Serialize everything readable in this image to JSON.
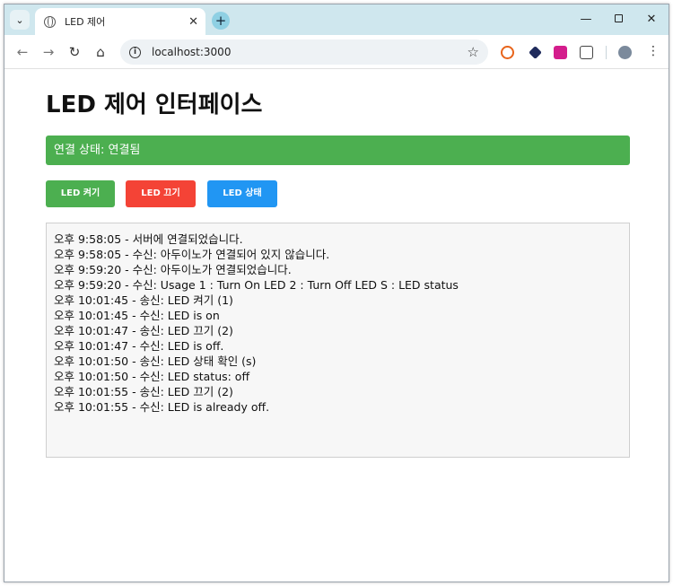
{
  "browser": {
    "tab_title": "LED 제어",
    "url": "localhost:3000"
  },
  "page": {
    "title": "LED 제어 인터페이스",
    "status_text": "연결 상태: 연결됨",
    "status_color": "#4caf50",
    "buttons": {
      "on_label": "LED 켜기",
      "off_label": "LED 끄기",
      "status_label": "LED 상태"
    },
    "button_colors": {
      "on": "#4caf50",
      "off": "#f44336",
      "status": "#2196f3"
    },
    "log": [
      "오후 9:58:05 - 서버에 연결되었습니다.",
      "오후 9:58:05 - 수신: 아두이노가 연결되어 있지 않습니다.",
      "오후 9:59:20 - 수신: 아두이노가 연결되었습니다.",
      "오후 9:59:20 - 수신: Usage 1 : Turn On LED 2 : Turn Off LED S : LED status",
      "오후 10:01:45 - 송신: LED 켜기 (1)",
      "오후 10:01:45 - 수신: LED is on",
      "오후 10:01:47 - 송신: LED 끄기 (2)",
      "오후 10:01:47 - 수신: LED is off.",
      "오후 10:01:50 - 송신: LED 상태 확인 (s)",
      "오후 10:01:50 - 수신: LED status: off",
      "오후 10:01:55 - 송신: LED 끄기 (2)",
      "오후 10:01:55 - 수신: LED is already off."
    ]
  }
}
